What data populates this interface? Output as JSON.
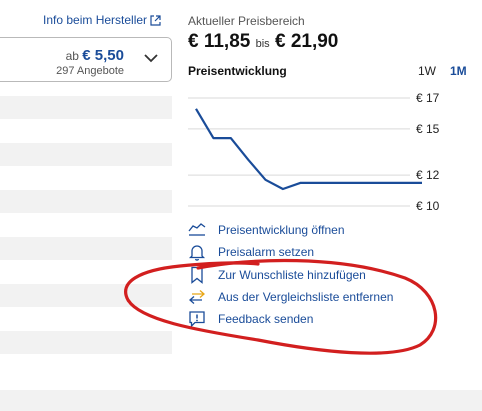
{
  "left": {
    "manufacturer_link": "Info beim Hersteller",
    "offer": {
      "prefix": "ab",
      "price": "€ 5,50",
      "count": "297 Angebote"
    }
  },
  "right": {
    "price_range_label": "Aktueller Preisbereich",
    "price_min": "€ 11,85",
    "price_sep": "bis",
    "price_max": "€ 21,90",
    "chart_title": "Preisentwicklung",
    "range_buttons": [
      "1W",
      "1M"
    ],
    "selected_range": "1M",
    "actions": [
      {
        "label": "Preisentwicklung öffnen",
        "icon": "chart-icon"
      },
      {
        "label": "Preisalarm setzen",
        "icon": "bell-icon"
      },
      {
        "label": "Zur Wunschliste hinzufügen",
        "icon": "bookmark-icon"
      },
      {
        "label": "Aus der Vergleichsliste entfernen",
        "icon": "compare-arrows-icon"
      },
      {
        "label": "Feedback senden",
        "icon": "feedback-icon"
      }
    ]
  },
  "colors": {
    "link": "#1a4c99",
    "line": "#1a4c99",
    "annotation": "#d21f1f"
  },
  "chart_data": {
    "type": "line",
    "title": "Preisentwicklung",
    "xlabel": "",
    "ylabel": "",
    "y_tick_labels": [
      "€ 17",
      "€ 15",
      "€ 12",
      "€ 10"
    ],
    "y_ticks": [
      17,
      15,
      12,
      10
    ],
    "ylim": [
      10,
      17
    ],
    "grid": true,
    "series": [
      {
        "values": [
          16.3,
          14.4,
          14.4,
          13.0,
          11.7,
          11.1,
          11.5,
          11.5,
          11.5,
          11.5,
          11.5,
          11.5,
          11.5,
          11.5
        ]
      }
    ]
  }
}
